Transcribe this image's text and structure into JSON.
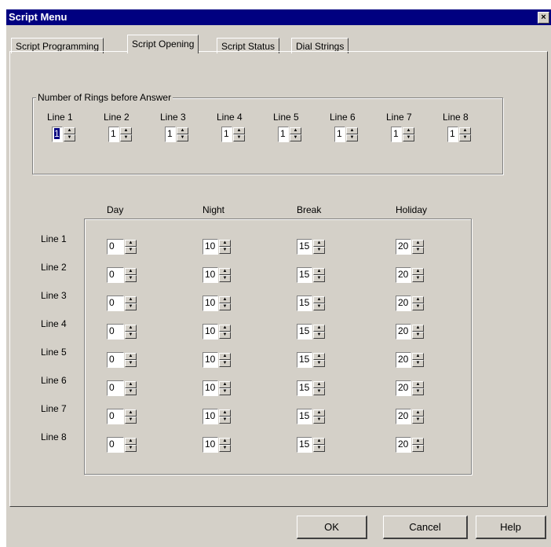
{
  "window": {
    "title": "Script Menu",
    "close_glyph": "×"
  },
  "tabs": [
    {
      "label": "Script Programming"
    },
    {
      "label": "Script Opening"
    },
    {
      "label": "Script Status"
    },
    {
      "label": "Dial Strings"
    }
  ],
  "active_tab": "Script Opening",
  "rings": {
    "group_label": "Number of Rings before Answer",
    "lines": [
      {
        "label": "Line 1",
        "value": "1"
      },
      {
        "label": "Line 2",
        "value": "1"
      },
      {
        "label": "Line 3",
        "value": "1"
      },
      {
        "label": "Line 4",
        "value": "1"
      },
      {
        "label": "Line 5",
        "value": "1"
      },
      {
        "label": "Line 6",
        "value": "1"
      },
      {
        "label": "Line 7",
        "value": "1"
      },
      {
        "label": "Line 8",
        "value": "1"
      }
    ]
  },
  "schedule": {
    "columns": [
      "Day",
      "Night",
      "Break",
      "Holiday"
    ],
    "rows": [
      {
        "label": "Line 1",
        "values": [
          "0",
          "10",
          "15",
          "20"
        ]
      },
      {
        "label": "Line 2",
        "values": [
          "0",
          "10",
          "15",
          "20"
        ]
      },
      {
        "label": "Line 3",
        "values": [
          "0",
          "10",
          "15",
          "20"
        ]
      },
      {
        "label": "Line 4",
        "values": [
          "0",
          "10",
          "15",
          "20"
        ]
      },
      {
        "label": "Line 5",
        "values": [
          "0",
          "10",
          "15",
          "20"
        ]
      },
      {
        "label": "Line 6",
        "values": [
          "0",
          "10",
          "15",
          "20"
        ]
      },
      {
        "label": "Line 7",
        "values": [
          "0",
          "10",
          "15",
          "20"
        ]
      },
      {
        "label": "Line 8",
        "values": [
          "0",
          "10",
          "15",
          "20"
        ]
      }
    ]
  },
  "buttons": {
    "ok": "OK",
    "cancel": "Cancel",
    "help": "Help"
  },
  "icons": {
    "spin_up": "spin-up-arrow-icon",
    "spin_down": "spin-down-arrow-icon"
  },
  "colors": {
    "face": "#d4d0c8",
    "titlebar": "#000080",
    "selection": "#000080"
  }
}
